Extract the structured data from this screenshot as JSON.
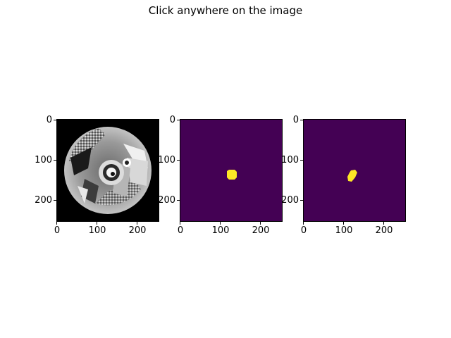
{
  "figure": {
    "title": "Click anywhere on the image"
  },
  "axes": [
    {
      "name": "mri-slice",
      "kind": "grayscale-image",
      "y_ticks": [
        "0",
        "100",
        "200"
      ],
      "x_ticks": [
        "0",
        "100",
        "200"
      ]
    },
    {
      "name": "segmentation-mask-1",
      "kind": "mask",
      "y_ticks": [
        "0",
        "100",
        "200"
      ],
      "x_ticks": [
        "0",
        "100",
        "200"
      ]
    },
    {
      "name": "segmentation-mask-2",
      "kind": "mask",
      "y_ticks": [
        "0",
        "100",
        "200"
      ],
      "x_ticks": [
        "0",
        "100",
        "200"
      ]
    }
  ],
  "colors": {
    "mask_background": "#440154",
    "mask_foreground": "#fde725"
  }
}
